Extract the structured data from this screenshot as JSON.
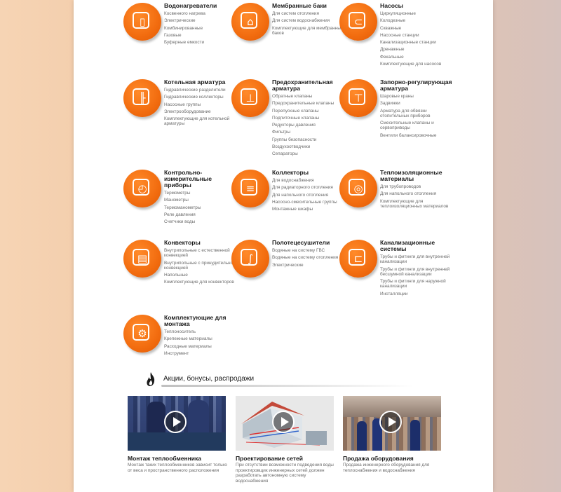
{
  "categories": [
    {
      "title": "Водонагреватели",
      "icon": "water-heater-icon",
      "glyph": "▯",
      "items": [
        "Косвенного нагрева",
        "Электрические",
        "Комбинированные",
        "Газовые",
        "Буферные емкости"
      ]
    },
    {
      "title": "Мембранные баки",
      "icon": "membrane-tank-icon",
      "glyph": "⌂",
      "items": [
        "Для систем отопления",
        "Для систем водоснабжения",
        "Комплектующие для мембранных баков"
      ]
    },
    {
      "title": "Насосы",
      "icon": "pump-icon",
      "glyph": "⊂",
      "items": [
        "Циркуляционные",
        "Колодезные",
        "Скважные",
        "Насосные станции",
        "Канализационные станции",
        "Дренажные",
        "Фекальные",
        "Комплектующие для насосов"
      ]
    },
    {
      "title": "Котельная арматура",
      "icon": "boiler-fittings-icon",
      "glyph": "╟",
      "items": [
        "Гидравлические разделители",
        "Гидравлические коллекторы",
        "Насосные группы",
        "Электрооборудование",
        "Комплектующие для котельной арматуры"
      ]
    },
    {
      "title": "Предохранительная арматура",
      "icon": "safety-valve-icon",
      "glyph": "⊥",
      "items": [
        "Обратные клапаны",
        "Предохранительные клапаны",
        "Перепускные клапаны",
        "Подпиточные клапаны",
        "Редукторы давления",
        "Фильтры",
        "Группы безопасности",
        "Воздухоотводчики",
        "Сепараторы"
      ]
    },
    {
      "title": "Запорно-регулирующая арматура",
      "icon": "shutoff-valve-icon",
      "glyph": "⊤",
      "items": [
        "Шаровые краны",
        "Задвижки",
        "Арматура для обвязки отопительных приборов",
        "Смесительные клапаны и сервоприводы",
        "Вентили балансировочные"
      ]
    },
    {
      "title": "Контрольно-измерительные приборы",
      "icon": "gauge-icon",
      "glyph": "◴",
      "items": [
        "Термометры",
        "Манометры",
        "Термоманометры",
        "Реле давления",
        "Счетчики воды"
      ]
    },
    {
      "title": "Коллекторы",
      "icon": "manifold-icon",
      "glyph": "≡",
      "items": [
        "Для водоснабжения",
        "Для радиаторного отопления",
        "Для напольного отопления",
        "Насосно-смесительные группы",
        "Монтажные шкафы"
      ]
    },
    {
      "title": "Теплоизоляционные материалы",
      "icon": "insulation-icon",
      "glyph": "◎",
      "items": [
        "Для трубопроводов",
        "Для напольного отопления",
        "Комплектующие для теплоизоляционных материалов"
      ]
    },
    {
      "title": "Конвекторы",
      "icon": "convector-icon",
      "glyph": "▤",
      "items": [
        "Внутрипольные с естественной конвекцией",
        "Внутрипольные с принудительной конвекцией",
        "Напольные",
        "Комплектующие для конвекторов"
      ]
    },
    {
      "title": "Полотецесушители",
      "icon": "towel-dryer-icon",
      "glyph": "∫",
      "items": [
        "Водяные на систему ГВС",
        "Водяные на систему отопления",
        "Электрические"
      ]
    },
    {
      "title": "Канализационные системы",
      "icon": "sewer-icon",
      "glyph": "⊏",
      "items": [
        "Трубы и фитинги для внутренней канализации",
        "Трубы и фитинги для внутренней бесшумной канализации",
        "Трубы и фитинги для наружной канализации",
        "Инсталляции"
      ]
    },
    {
      "title": "Комплектующие для монтажа",
      "icon": "mounting-parts-icon",
      "glyph": "⚙",
      "items": [
        "Теплоноситель",
        "Крепежные материалы",
        "Расходные материалы",
        "Инструмент"
      ]
    }
  ],
  "promo": {
    "heading": "Акции, бонусы, распродажи",
    "heading_icon": "flame-icon",
    "cards": [
      {
        "title": "Монтаж теплообменника",
        "desc": "Монтаж таких теплообменников зависит только от веса и пространственного расположения"
      },
      {
        "title": "Проектирование сетей",
        "desc": "При отсутствии возможности подведения воды проектировщик инженерных сетей должен разработать автономную систему водоснабжения"
      },
      {
        "title": "Продажа оборудования",
        "desc": "Продажа инженерного оборудования для теплоснабжения и водоснабжения"
      }
    ]
  },
  "colors": {
    "accent": "#f26c0f",
    "background": "#f4cfae",
    "text": "#1a1a1a",
    "muted": "#6b6b6b"
  }
}
